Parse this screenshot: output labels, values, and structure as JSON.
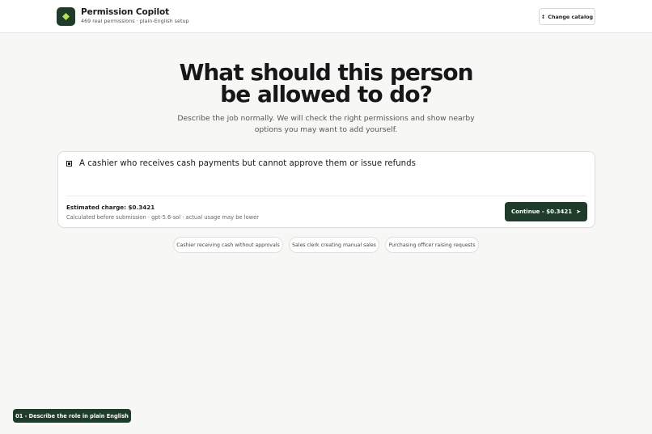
{
  "header": {
    "title": "Permission Copilot",
    "subtitle": "469 real permissions · plain-English setup",
    "logo_icon": "diamond-icon",
    "change_catalog_icon": "swap-vertical-icon",
    "change_catalog_label": "Change catalog"
  },
  "hero": {
    "headline_line1": "What should this person",
    "headline_line2": "be allowed to do?",
    "description": "Describe the job normally. We will check the right permissions and show nearby options you may want to add yourself."
  },
  "composer": {
    "input_icon": "square-icon",
    "input_value": "A cashier who receives cash payments but cannot approve them or issue refunds",
    "estimated_charge": "Estimated charge: $0.3421",
    "charge_note": "Calculated before submission · gpt-5.6-sol · actual usage may be lower",
    "continue_label": "Continue - $0.3421",
    "continue_icon": "arrow-right-icon"
  },
  "suggestions": [
    "Cashier receiving cash without approvals",
    "Sales clerk creating manual sales",
    "Purchasing officer raising requests"
  ],
  "step": {
    "label": "01 - Describe the role in plain English"
  },
  "colors": {
    "brand": "#1f3b2a",
    "accent_icon": "#b6e34a",
    "background": "#f7f7f5"
  }
}
